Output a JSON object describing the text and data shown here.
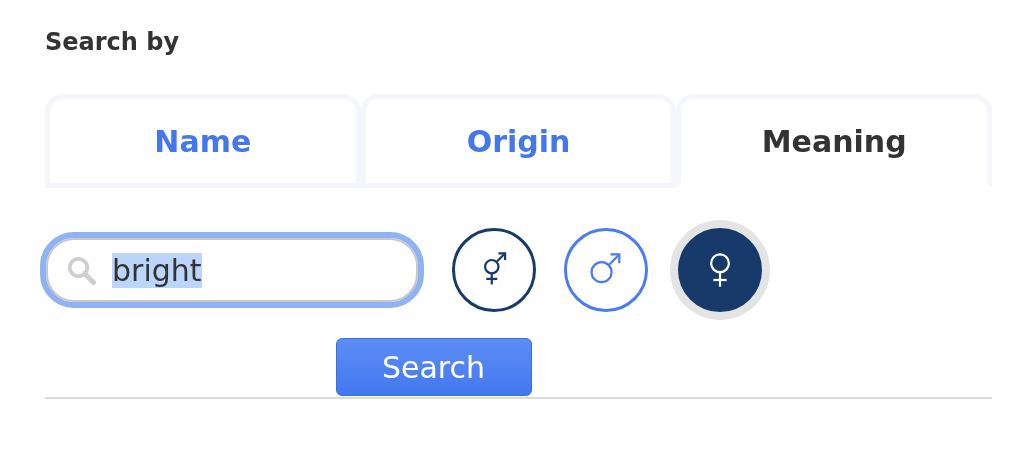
{
  "heading": "Search by",
  "tabs": [
    {
      "label": "Name",
      "selected": false
    },
    {
      "label": "Origin",
      "selected": false
    },
    {
      "label": "Meaning",
      "selected": true
    }
  ],
  "search": {
    "value": "bright"
  },
  "genders": [
    {
      "kind": "unisex",
      "selected": false
    },
    {
      "kind": "male",
      "selected": false
    },
    {
      "kind": "female",
      "selected": true
    }
  ],
  "button": "Search"
}
